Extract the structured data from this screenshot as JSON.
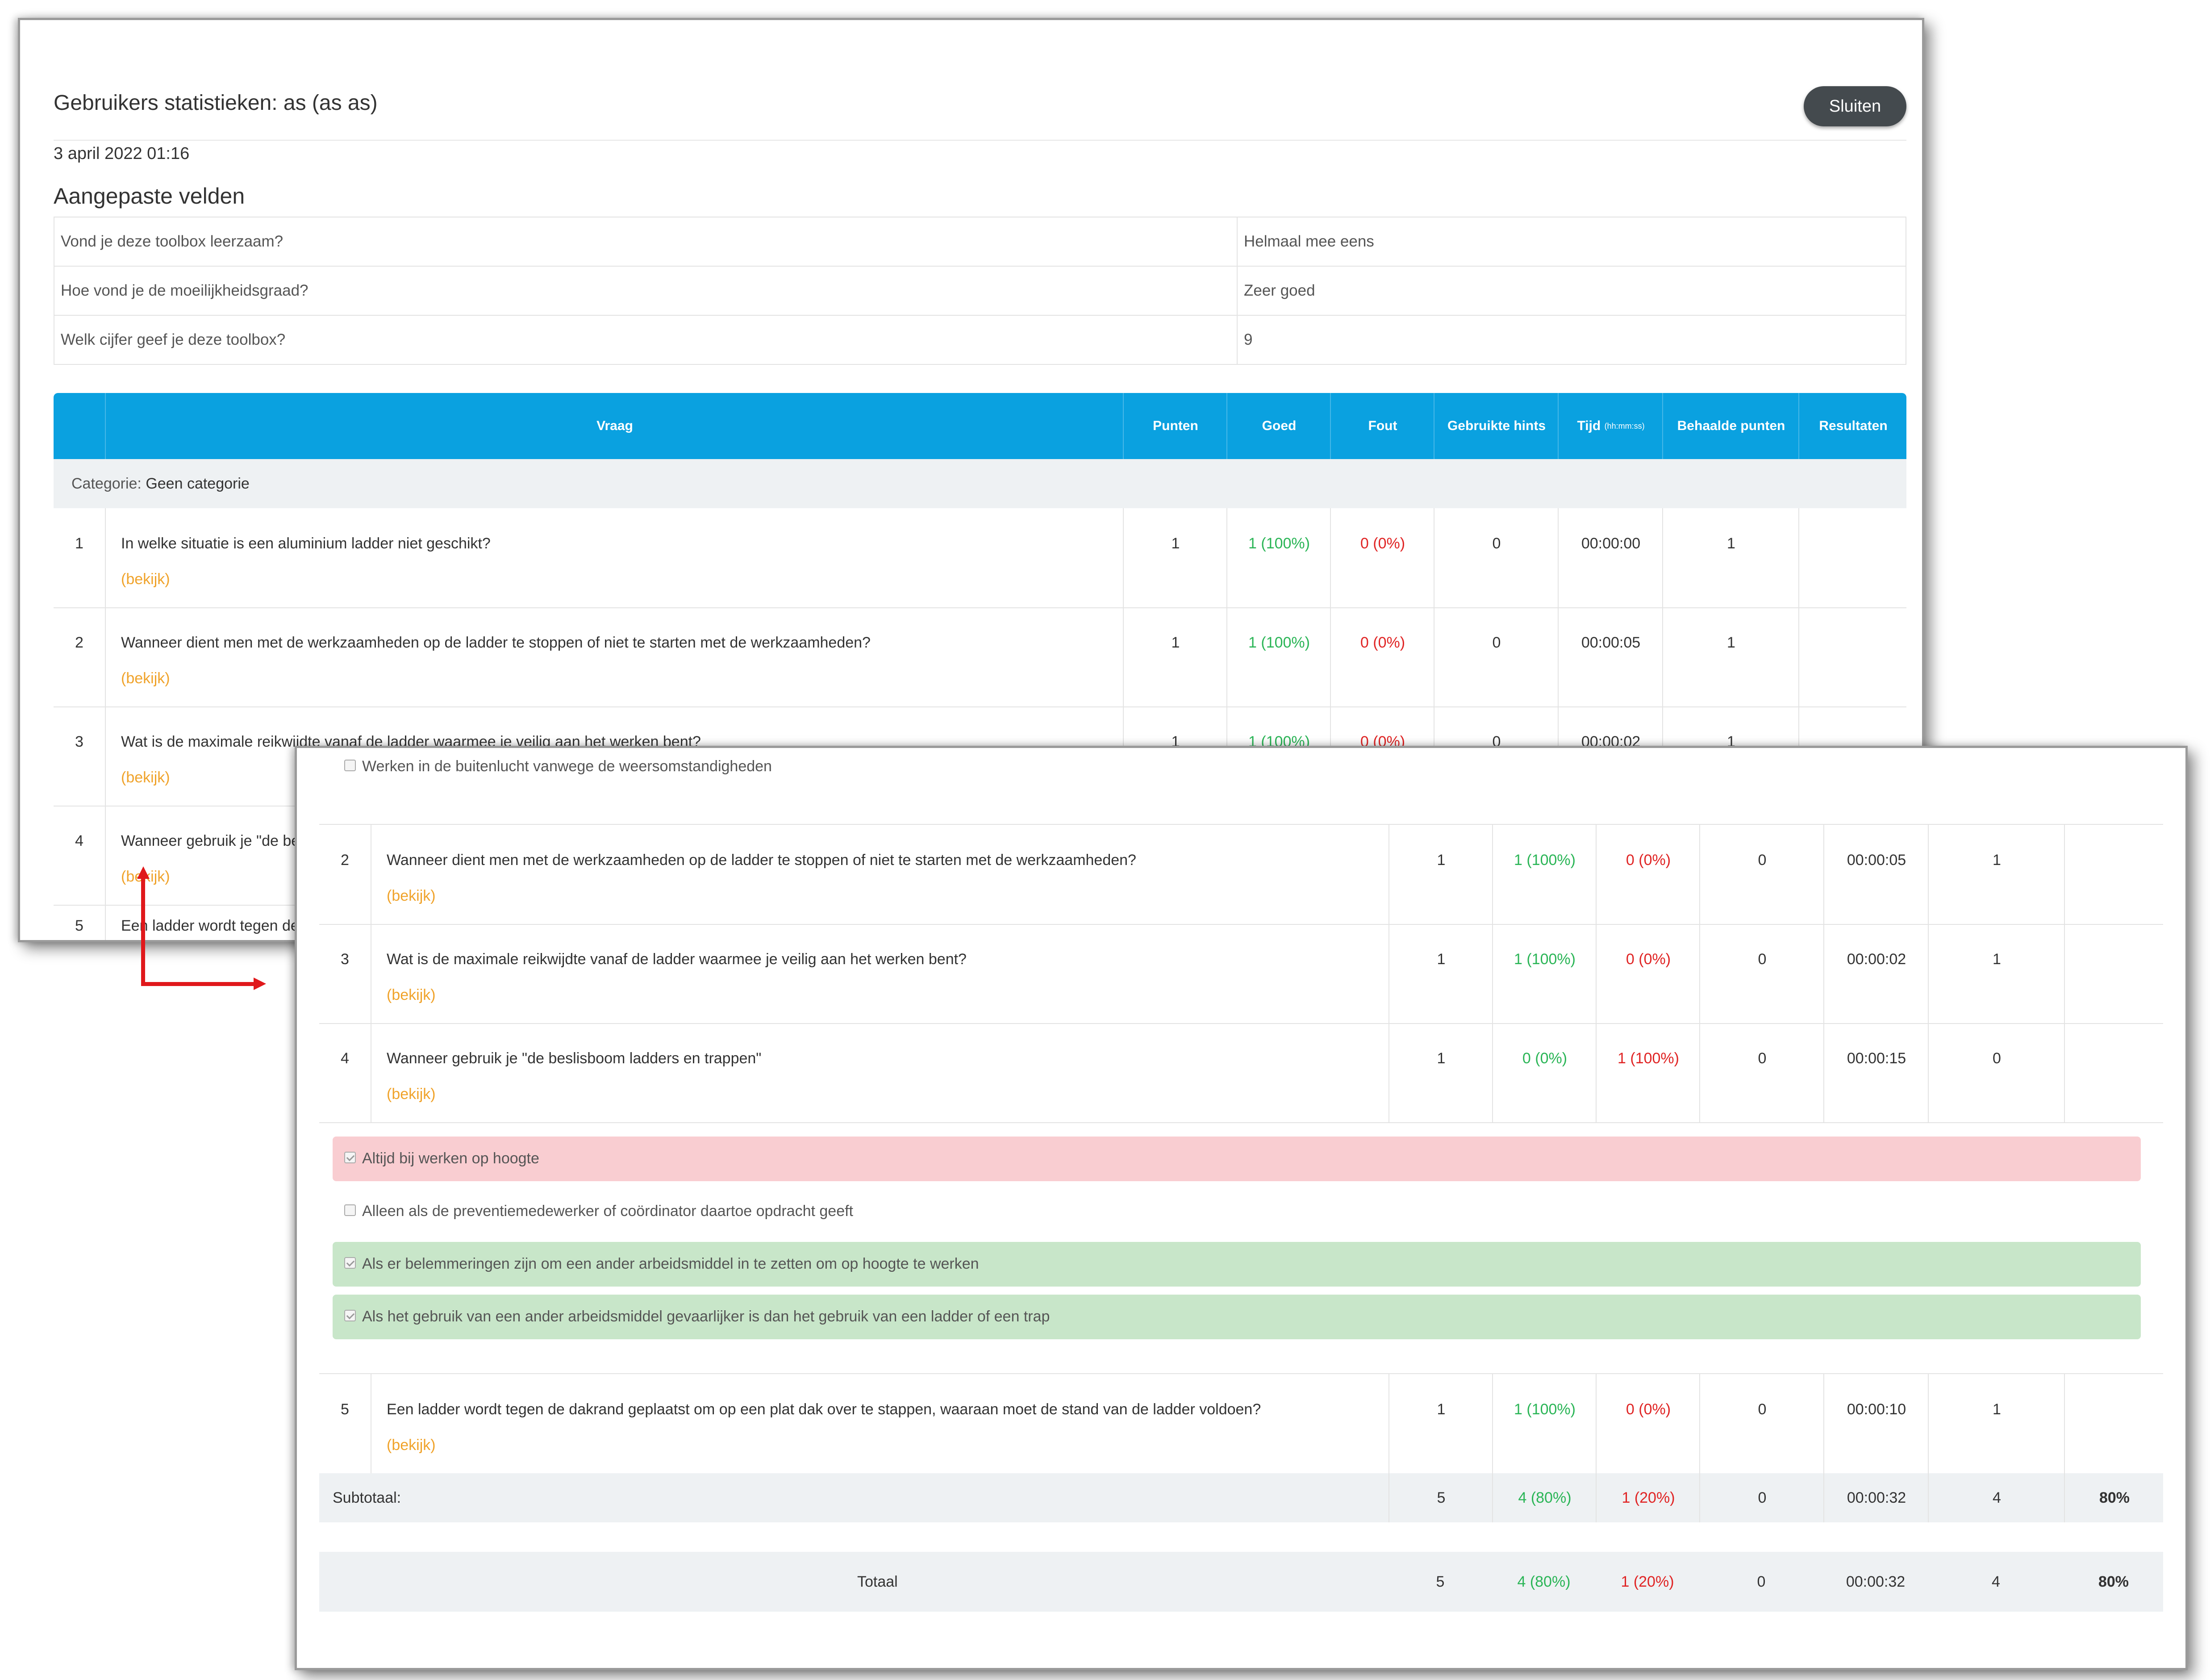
{
  "stats": {
    "title": "Gebruikers statistieken: as (as as)",
    "close_label": "Sluiten",
    "date": "3 april 2022 01:16",
    "custom_fields_title": "Aangepaste velden",
    "custom_fields": [
      {
        "question": "Vond je deze toolbox leerzaam?",
        "answer": "Helmaal mee eens"
      },
      {
        "question": "Hoe vond je de moeilijkheidsgraad?",
        "answer": "Zeer goed"
      },
      {
        "question": "Welk cijfer geef je deze toolbox?",
        "answer": "9"
      }
    ],
    "columns": {
      "vraag": "Vraag",
      "punten": "Punten",
      "goed": "Goed",
      "fout": "Fout",
      "hints": "Gebruikte hints",
      "tijd": "Tijd",
      "tijd_format": "(hh:mm:ss)",
      "behaald": "Behaalde punten",
      "resultaten": "Resultaten"
    },
    "category_label": "Categorie:",
    "category_name": "Geen categorie",
    "view_label": "(bekijk)",
    "questions": [
      {
        "num": "1",
        "text": "In welke situatie is een aluminium ladder niet geschikt?",
        "punten": "1",
        "goed": "1 (100%)",
        "fout": "0 (0%)",
        "hints": "0",
        "tijd": "00:00:00",
        "behaald": "1"
      },
      {
        "num": "2",
        "text": "Wanneer dient men met de werkzaamheden op de ladder te stoppen of niet te starten met de werkzaamheden?",
        "punten": "1",
        "goed": "1 (100%)",
        "fout": "0 (0%)",
        "hints": "0",
        "tijd": "00:00:05",
        "behaald": "1"
      },
      {
        "num": "3",
        "text": "Wat is de maximale reikwijdte vanaf de ladder waarmee je veilig aan het werken bent?",
        "punten": "1",
        "goed": "1 (100%)",
        "fout": "0 (0%)",
        "hints": "0",
        "tijd": "00:00:02",
        "behaald": "1"
      },
      {
        "num": "4",
        "text": "Wanneer gebruik je \"de beslisboom ladders en trappen\"",
        "text_cut": "Wanneer gebruik je \"de be",
        "punten": "1",
        "goed": "0 (0%)",
        "fout": "1 (100%)",
        "hints": "0",
        "tijd": "00:00:15",
        "behaald": "0"
      },
      {
        "num": "5",
        "text": "Een ladder wordt tegen de dakrand geplaatst om op een plat dak over te stappen, waaraan moet de stand van de ladder voldoen?",
        "text_cut": "Een ladder wordt tegen de",
        "punten": "1",
        "goed": "1 (100%)",
        "fout": "0 (0%)",
        "hints": "0",
        "tijd": "00:00:10",
        "behaald": "1"
      }
    ],
    "top_option": "Werken in de buitenlucht vanwege de weersomstandigheden",
    "q4_options": [
      {
        "text": "Altijd bij werken op hoogte",
        "checked": true,
        "state": "wrong"
      },
      {
        "text": "Alleen als de preventiemedewerker of coördinator daartoe opdracht geeft",
        "checked": false,
        "state": "none"
      },
      {
        "text": "Als er belemmeringen zijn om een ander arbeidsmiddel in te zetten om op hoogte te werken",
        "checked": true,
        "state": "correct"
      },
      {
        "text": "Als het gebruik van een ander arbeidsmiddel gevaarlijker is dan het gebruik van een ladder of een trap",
        "checked": true,
        "state": "correct"
      }
    ],
    "subtotal": {
      "label": "Subtotaal:",
      "punten": "5",
      "goed": "4 (80%)",
      "fout": "1 (20%)",
      "hints": "0",
      "tijd": "00:00:32",
      "behaald": "4",
      "resultaat": "80%"
    },
    "total": {
      "label": "Totaal",
      "punten": "5",
      "goed": "4 (80%)",
      "fout": "1 (20%)",
      "hints": "0",
      "tijd": "00:00:32",
      "behaald": "4",
      "resultaat": "80%"
    }
  },
  "colors": {
    "header_blue": "#0aa1e0",
    "correct_green": "#2ab556",
    "wrong_red": "#e02424",
    "link_orange": "#f0a32b",
    "annotation_arrow": "#e0181b"
  }
}
